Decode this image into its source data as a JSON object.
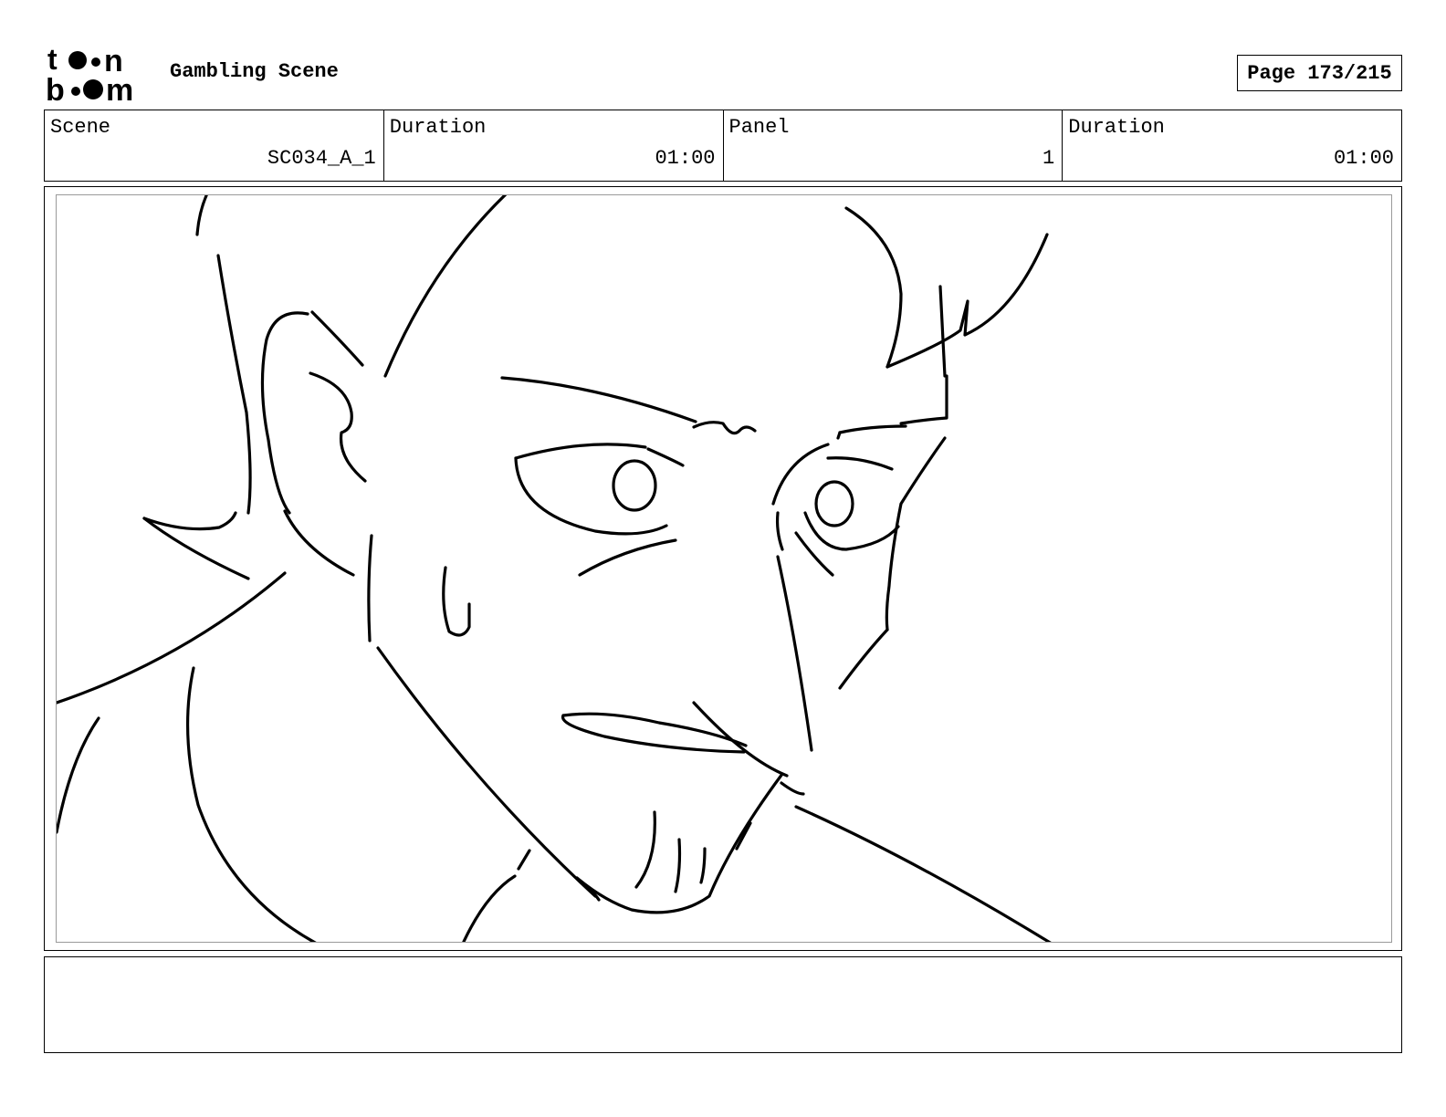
{
  "header": {
    "logo_text_top": "toon",
    "logo_text_bottom": "boom",
    "title": "Gambling Scene",
    "page_label": "Page 173/215"
  },
  "info": {
    "scene_label": "Scene",
    "scene_value": "SC034_A_1",
    "scene_duration_label": "Duration",
    "scene_duration_value": "01:00",
    "panel_label": "Panel",
    "panel_value": "1",
    "panel_duration_label": "Duration",
    "panel_duration_value": "01:00"
  },
  "notes": {
    "text": ""
  }
}
